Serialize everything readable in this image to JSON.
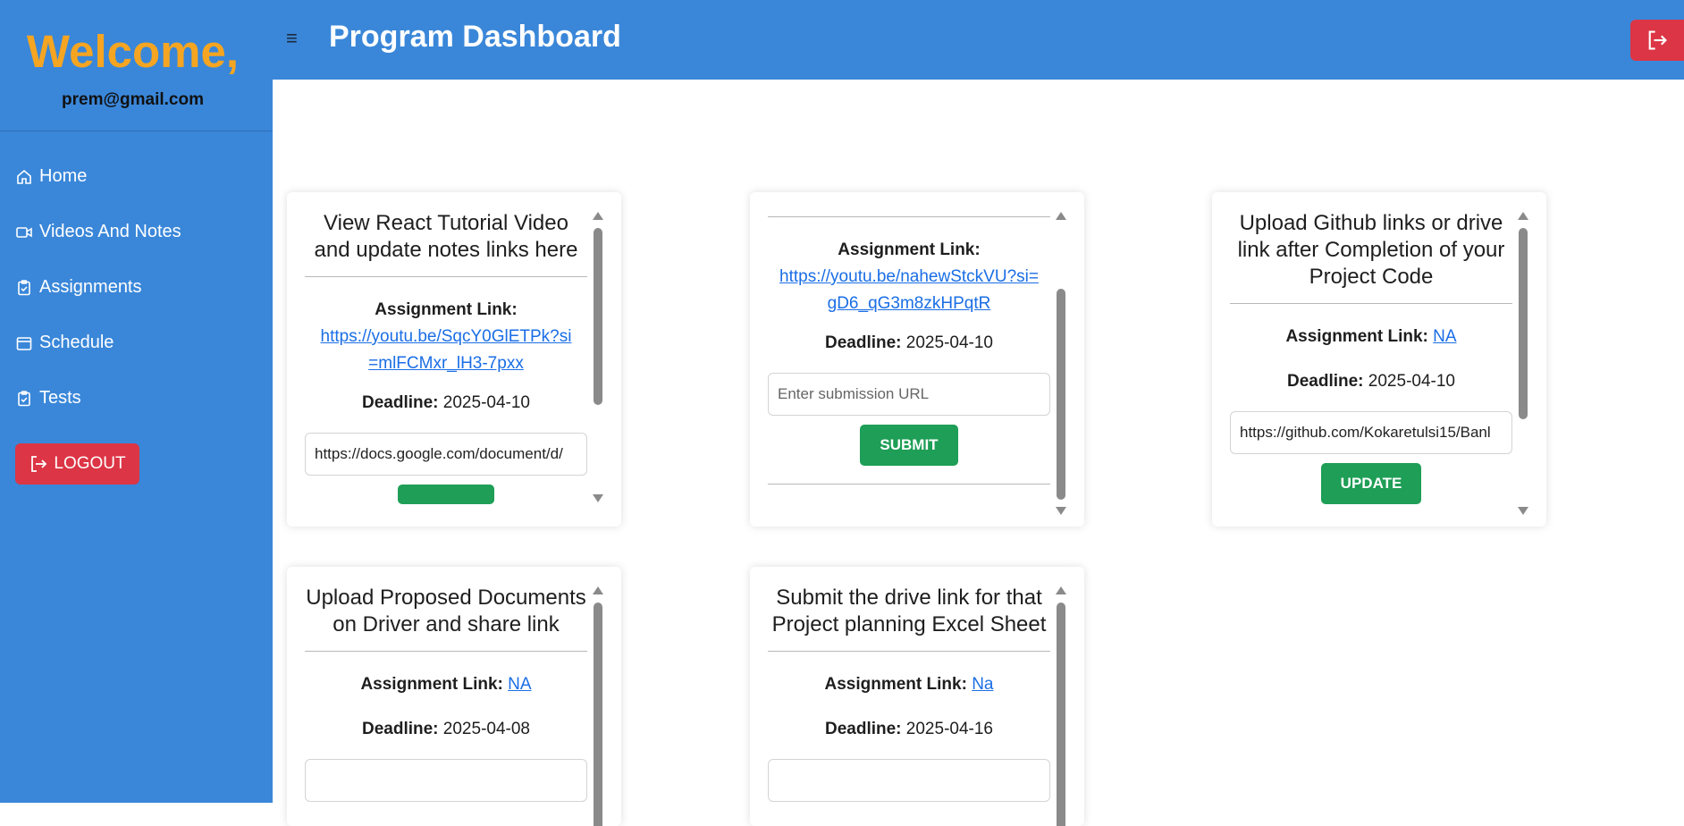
{
  "sidebar": {
    "welcome": "Welcome,",
    "email": "prem@gmail.com",
    "items": [
      {
        "label": "Home"
      },
      {
        "label": "Videos And Notes"
      },
      {
        "label": "Assignments"
      },
      {
        "label": "Schedule"
      },
      {
        "label": "Tests"
      }
    ],
    "logout_label": "LOGOUT"
  },
  "header": {
    "menu_glyph": "≡",
    "title": "Program Dashboard"
  },
  "colors": {
    "primary": "#3a87d9",
    "welcome": "#f5a521",
    "danger": "#dc3545",
    "success": "#1e9e56",
    "link": "#1a6ee5"
  },
  "cards": [
    {
      "title": "View React Tutorial Video and update notes links here",
      "assignment_label": "Assignment Link:",
      "assignment_link": "https://youtu.be/SqcY0GlETPk?si=mlFCMxr_lH3-7pxx",
      "deadline_label": "Deadline:",
      "deadline": "2025-04-10",
      "input_value": "https://docs.google.com/document/d/",
      "button": ""
    },
    {
      "title": "",
      "assignment_label": "Assignment Link:",
      "assignment_link": "https://youtu.be/nahewStckVU?si=gD6_qG3m8zkHPqtR",
      "deadline_label": "Deadline:",
      "deadline": "2025-04-10",
      "input_placeholder": "Enter submission URL",
      "button": "SUBMIT"
    },
    {
      "title": "Upload Github links or drive link after Completion of your Project Code",
      "assignment_label": "Assignment Link:",
      "assignment_link": "NA",
      "deadline_label": "Deadline:",
      "deadline": "2025-04-10",
      "input_value": "https://github.com/Kokaretulsi15/Banl",
      "button": "UPDATE"
    },
    {
      "title": "Upload Proposed Documents on Driver and share link",
      "assignment_label": "Assignment Link:",
      "assignment_link": "NA",
      "deadline_label": "Deadline:",
      "deadline": "2025-04-08"
    },
    {
      "title": "Submit the drive link for that Project planning Excel Sheet",
      "assignment_label": "Assignment Link:",
      "assignment_link": "Na",
      "deadline_label": "Deadline:",
      "deadline": "2025-04-16"
    }
  ]
}
